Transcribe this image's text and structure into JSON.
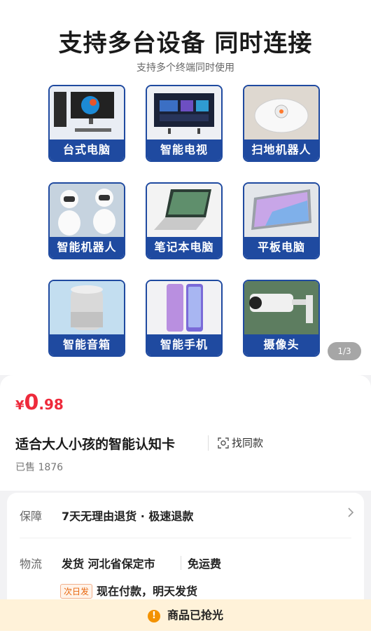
{
  "hero": {
    "title": "支持多台设备 同时连接",
    "subtitle": "支持多个终端同时使用",
    "devices": [
      {
        "label": "台式电脑",
        "icon": "desktop-computer-icon"
      },
      {
        "label": "智能电视",
        "icon": "smart-tv-icon"
      },
      {
        "label": "扫地机器人",
        "icon": "robot-vacuum-icon"
      },
      {
        "label": "智能机器人",
        "icon": "smart-robot-icon"
      },
      {
        "label": "笔记本电脑",
        "icon": "laptop-icon"
      },
      {
        "label": "平板电脑",
        "icon": "tablet-icon"
      },
      {
        "label": "智能音箱",
        "icon": "smart-speaker-icon"
      },
      {
        "label": "智能手机",
        "icon": "smartphone-icon"
      },
      {
        "label": "摄像头",
        "icon": "camera-icon"
      }
    ],
    "pager": "1/3"
  },
  "product": {
    "currency": "¥",
    "price_int": "0",
    "price_dec": ".98",
    "title": "适合大人小孩的智能认知卡",
    "find_similar": "找同款",
    "sold": "已售 1876"
  },
  "service": {
    "guarantee_label": "保障",
    "guarantee_text": "7天无理由退货 · 极速退款",
    "logistics_label": "物流",
    "ship_from": "发货 河北省保定市",
    "free_shipping": "免运费",
    "next_day_tag": "次日发",
    "ship_note": "现在付款，明天发货"
  },
  "status": {
    "sold_out": "商品已抢光"
  },
  "colors": {
    "accent_blue": "#1f4aa0",
    "price_red": "#ee2a3b",
    "warn_orange": "#f39200"
  }
}
